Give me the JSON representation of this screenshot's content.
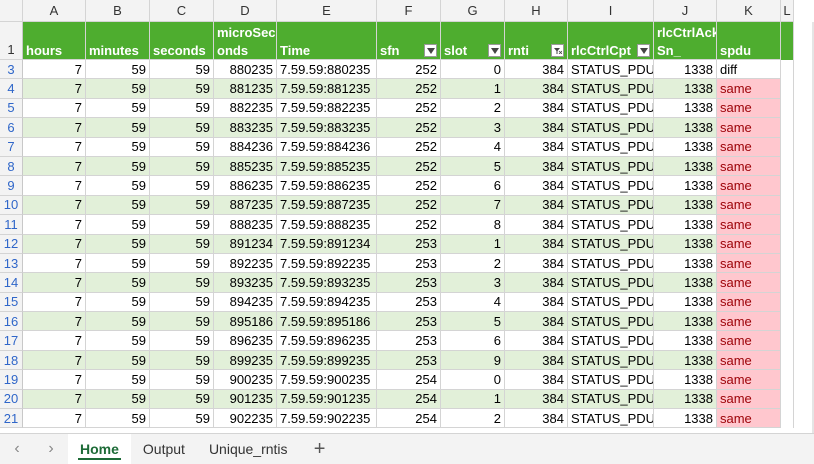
{
  "columns": [
    "A",
    "B",
    "C",
    "D",
    "E",
    "F",
    "G",
    "H",
    "I",
    "J",
    "K",
    "L"
  ],
  "header": {
    "row": "1",
    "hours": "hours",
    "minutes": "minutes",
    "seconds": "seconds",
    "micro_top": "microSec",
    "micro_bottom": "onds",
    "time": "Time",
    "sfn": "sfn",
    "slot": "slot",
    "rnti": "rnti",
    "ctrlcpt": "rlcCtrlCpt",
    "ack_top": "rlcCtrlAck",
    "ack_bottom": "Sn_",
    "spdu": "spdu"
  },
  "rows": [
    {
      "r": "3",
      "a": "7",
      "b": "59",
      "c": "59",
      "d": "880235",
      "e": "7.59.59:880235",
      "f": "252",
      "g": "0",
      "h": "384",
      "i": "STATUS_PDU",
      "j": "1338",
      "k": "diff"
    },
    {
      "r": "4",
      "a": "7",
      "b": "59",
      "c": "59",
      "d": "881235",
      "e": "7.59.59:881235",
      "f": "252",
      "g": "1",
      "h": "384",
      "i": "STATUS_PDU",
      "j": "1338",
      "k": "same"
    },
    {
      "r": "5",
      "a": "7",
      "b": "59",
      "c": "59",
      "d": "882235",
      "e": "7.59.59:882235",
      "f": "252",
      "g": "2",
      "h": "384",
      "i": "STATUS_PDU",
      "j": "1338",
      "k": "same"
    },
    {
      "r": "6",
      "a": "7",
      "b": "59",
      "c": "59",
      "d": "883235",
      "e": "7.59.59:883235",
      "f": "252",
      "g": "3",
      "h": "384",
      "i": "STATUS_PDU",
      "j": "1338",
      "k": "same"
    },
    {
      "r": "7",
      "a": "7",
      "b": "59",
      "c": "59",
      "d": "884236",
      "e": "7.59.59:884236",
      "f": "252",
      "g": "4",
      "h": "384",
      "i": "STATUS_PDU",
      "j": "1338",
      "k": "same"
    },
    {
      "r": "8",
      "a": "7",
      "b": "59",
      "c": "59",
      "d": "885235",
      "e": "7.59.59:885235",
      "f": "252",
      "g": "5",
      "h": "384",
      "i": "STATUS_PDU",
      "j": "1338",
      "k": "same"
    },
    {
      "r": "9",
      "a": "7",
      "b": "59",
      "c": "59",
      "d": "886235",
      "e": "7.59.59:886235",
      "f": "252",
      "g": "6",
      "h": "384",
      "i": "STATUS_PDU",
      "j": "1338",
      "k": "same"
    },
    {
      "r": "10",
      "a": "7",
      "b": "59",
      "c": "59",
      "d": "887235",
      "e": "7.59.59:887235",
      "f": "252",
      "g": "7",
      "h": "384",
      "i": "STATUS_PDU",
      "j": "1338",
      "k": "same"
    },
    {
      "r": "11",
      "a": "7",
      "b": "59",
      "c": "59",
      "d": "888235",
      "e": "7.59.59:888235",
      "f": "252",
      "g": "8",
      "h": "384",
      "i": "STATUS_PDU",
      "j": "1338",
      "k": "same"
    },
    {
      "r": "12",
      "a": "7",
      "b": "59",
      "c": "59",
      "d": "891234",
      "e": "7.59.59:891234",
      "f": "253",
      "g": "1",
      "h": "384",
      "i": "STATUS_PDU",
      "j": "1338",
      "k": "same"
    },
    {
      "r": "13",
      "a": "7",
      "b": "59",
      "c": "59",
      "d": "892235",
      "e": "7.59.59:892235",
      "f": "253",
      "g": "2",
      "h": "384",
      "i": "STATUS_PDU",
      "j": "1338",
      "k": "same"
    },
    {
      "r": "14",
      "a": "7",
      "b": "59",
      "c": "59",
      "d": "893235",
      "e": "7.59.59:893235",
      "f": "253",
      "g": "3",
      "h": "384",
      "i": "STATUS_PDU",
      "j": "1338",
      "k": "same"
    },
    {
      "r": "15",
      "a": "7",
      "b": "59",
      "c": "59",
      "d": "894235",
      "e": "7.59.59:894235",
      "f": "253",
      "g": "4",
      "h": "384",
      "i": "STATUS_PDU",
      "j": "1338",
      "k": "same"
    },
    {
      "r": "16",
      "a": "7",
      "b": "59",
      "c": "59",
      "d": "895186",
      "e": "7.59.59:895186",
      "f": "253",
      "g": "5",
      "h": "384",
      "i": "STATUS_PDU",
      "j": "1338",
      "k": "same"
    },
    {
      "r": "17",
      "a": "7",
      "b": "59",
      "c": "59",
      "d": "896235",
      "e": "7.59.59:896235",
      "f": "253",
      "g": "6",
      "h": "384",
      "i": "STATUS_PDU",
      "j": "1338",
      "k": "same"
    },
    {
      "r": "18",
      "a": "7",
      "b": "59",
      "c": "59",
      "d": "899235",
      "e": "7.59.59:899235",
      "f": "253",
      "g": "9",
      "h": "384",
      "i": "STATUS_PDU",
      "j": "1338",
      "k": "same"
    },
    {
      "r": "19",
      "a": "7",
      "b": "59",
      "c": "59",
      "d": "900235",
      "e": "7.59.59:900235",
      "f": "254",
      "g": "0",
      "h": "384",
      "i": "STATUS_PDU",
      "j": "1338",
      "k": "same"
    },
    {
      "r": "20",
      "a": "7",
      "b": "59",
      "c": "59",
      "d": "901235",
      "e": "7.59.59:901235",
      "f": "254",
      "g": "1",
      "h": "384",
      "i": "STATUS_PDU",
      "j": "1338",
      "k": "same"
    },
    {
      "r": "21",
      "a": "7",
      "b": "59",
      "c": "59",
      "d": "902235",
      "e": "7.59.59:902235",
      "f": "254",
      "g": "2",
      "h": "384",
      "i": "STATUS_PDU",
      "j": "1338",
      "k": "same"
    }
  ],
  "tabs": {
    "prev_icon": "chevron-left-icon",
    "next_icon": "chevron-right-icon",
    "home": "Home",
    "output": "Output",
    "unique": "Unique_rntis",
    "add": "+"
  },
  "colors": {
    "header_green": "#4ead2f",
    "band_green": "#e2f0d9",
    "same_fill": "#ffc7ce",
    "same_text": "#9c0006"
  }
}
